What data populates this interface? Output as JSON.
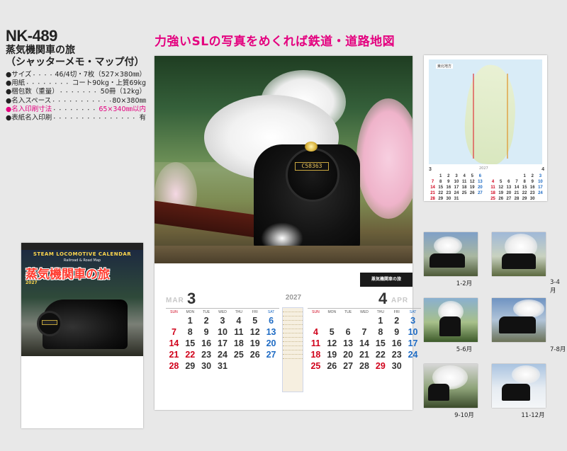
{
  "product": {
    "model_no": "NK-489",
    "title_line1": "蒸気機関車の旅",
    "title_line2": "（シャッターメモ・マップ付）",
    "specs": [
      {
        "key": "●サイズ",
        "value": "46/4切・7枚（527×380㎜）",
        "highlight": false
      },
      {
        "key": "●用紙",
        "value": "コート90kg・上質69kg",
        "highlight": false
      },
      {
        "key": "●梱包数（重量）",
        "value": "50冊（12kg）",
        "highlight": false
      },
      {
        "key": "●名入スペース",
        "value": "80×380㎜",
        "highlight": false
      },
      {
        "key": "●名入印刷寸法",
        "value": "65×340㎜以内",
        "highlight": true
      },
      {
        "key": "●表紙名入印刷",
        "value": "有",
        "highlight": false
      }
    ]
  },
  "headline": "力強いSLの写真をめくれば鉄道・道路地図",
  "cover": {
    "en_title": "STEAM LOCOMOTIVE CALENDAR",
    "en_sub": "Railroad & Road Map",
    "jp_title": "蒸気機関車の旅",
    "year": "2027"
  },
  "main_calendar": {
    "plate_text": "C58363",
    "logo_text": "蒸気機関車の旅",
    "year": "2027",
    "weekday_labels": [
      "SUN",
      "MON",
      "TUE",
      "WED",
      "THU",
      "FRI",
      "SAT"
    ],
    "months": [
      {
        "en": "MAR",
        "num": "3",
        "weeks": [
          [
            "",
            "1",
            "2",
            "3",
            "4",
            "5",
            "6"
          ],
          [
            "7",
            "8",
            "9",
            "10",
            "11",
            "12",
            "13"
          ],
          [
            "14",
            "15",
            "16",
            "17",
            "18",
            "19",
            "20"
          ],
          [
            "21",
            "22",
            "23",
            "24",
            "25",
            "26",
            "27"
          ],
          [
            "28",
            "29",
            "30",
            "31",
            "",
            "",
            ""
          ]
        ],
        "holidays": [
          "22"
        ]
      },
      {
        "en": "APR",
        "num": "4",
        "weeks": [
          [
            "",
            "",
            "",
            "",
            "1",
            "2",
            "3"
          ],
          [
            "4",
            "5",
            "6",
            "7",
            "8",
            "9",
            "10"
          ],
          [
            "11",
            "12",
            "13",
            "14",
            "15",
            "16",
            "17"
          ],
          [
            "18",
            "19",
            "20",
            "21",
            "22",
            "23",
            "24"
          ],
          [
            "25",
            "26",
            "27",
            "28",
            "29",
            "30",
            ""
          ]
        ],
        "holidays": [
          "29"
        ]
      }
    ]
  },
  "map_calendar": {
    "region": "東北地方",
    "left_month": "3",
    "right_month": "4",
    "year": "2027",
    "left_weeks": [
      [
        "",
        "1",
        "2",
        "3",
        "4",
        "5",
        "6"
      ],
      [
        "7",
        "8",
        "9",
        "10",
        "11",
        "12",
        "13"
      ],
      [
        "14",
        "15",
        "16",
        "17",
        "18",
        "19",
        "20"
      ],
      [
        "21",
        "22",
        "23",
        "24",
        "25",
        "26",
        "27"
      ],
      [
        "28",
        "29",
        "30",
        "31",
        "",
        "",
        ""
      ]
    ],
    "right_weeks": [
      [
        "",
        "",
        "",
        "",
        "1",
        "2",
        "3"
      ],
      [
        "4",
        "5",
        "6",
        "7",
        "8",
        "9",
        "10"
      ],
      [
        "11",
        "12",
        "13",
        "14",
        "15",
        "16",
        "17"
      ],
      [
        "18",
        "19",
        "20",
        "21",
        "22",
        "23",
        "24"
      ],
      [
        "25",
        "26",
        "27",
        "28",
        "29",
        "30",
        ""
      ]
    ]
  },
  "thumbnails": [
    {
      "label": "1-2月"
    },
    {
      "label": "3-4月"
    },
    {
      "label": "5-6月"
    },
    {
      "label": "7-8月"
    },
    {
      "label": "9-10月"
    },
    {
      "label": "11-12月"
    }
  ]
}
